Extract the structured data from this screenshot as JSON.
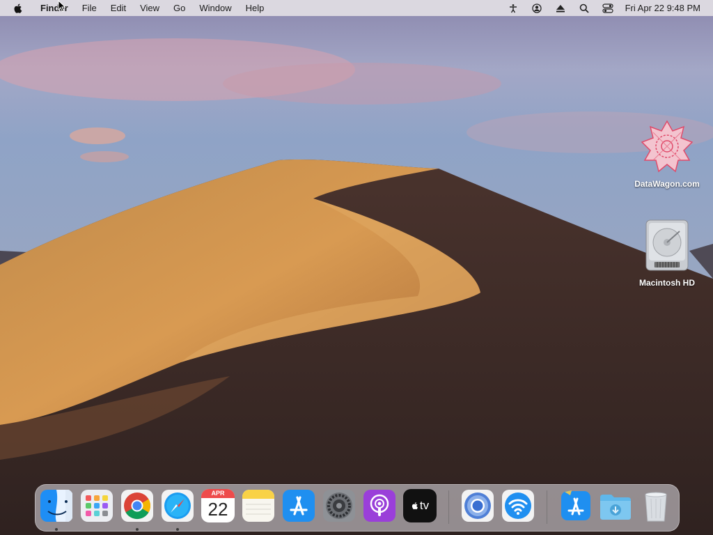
{
  "menubar": {
    "app_name": "Finder",
    "menus": [
      "File",
      "Edit",
      "View",
      "Go",
      "Window",
      "Help"
    ],
    "status_icons": [
      "accessibility-icon",
      "user-account-icon",
      "eject-icon",
      "spotlight-search-icon",
      "control-center-icon"
    ],
    "clock": "Fri Apr 22  9:48 PM"
  },
  "desktop": {
    "icons": [
      {
        "label": "DataWagon.com",
        "icon": "datawagon-logo"
      },
      {
        "label": "Macintosh HD",
        "icon": "hard-drive-icon"
      }
    ]
  },
  "dock": {
    "items": [
      {
        "name": "Finder",
        "running": true
      },
      {
        "name": "Launchpad",
        "running": false
      },
      {
        "name": "Google Chrome",
        "running": true
      },
      {
        "name": "Safari",
        "running": true
      },
      {
        "name": "Calendar",
        "running": false,
        "month": "APR",
        "day": "22"
      },
      {
        "name": "Notes",
        "running": false
      },
      {
        "name": "App Store",
        "running": false
      },
      {
        "name": "System Preferences",
        "running": false
      },
      {
        "name": "Podcasts",
        "running": false
      },
      {
        "name": "Apple TV",
        "running": false,
        "label": "tv"
      },
      {
        "name": "Chromium",
        "running": false
      },
      {
        "name": "Wi-Fi Utility",
        "running": false
      },
      {
        "name": "App Store Installer",
        "running": false
      },
      {
        "name": "Downloads",
        "running": false
      },
      {
        "name": "Trash",
        "running": false
      }
    ]
  }
}
